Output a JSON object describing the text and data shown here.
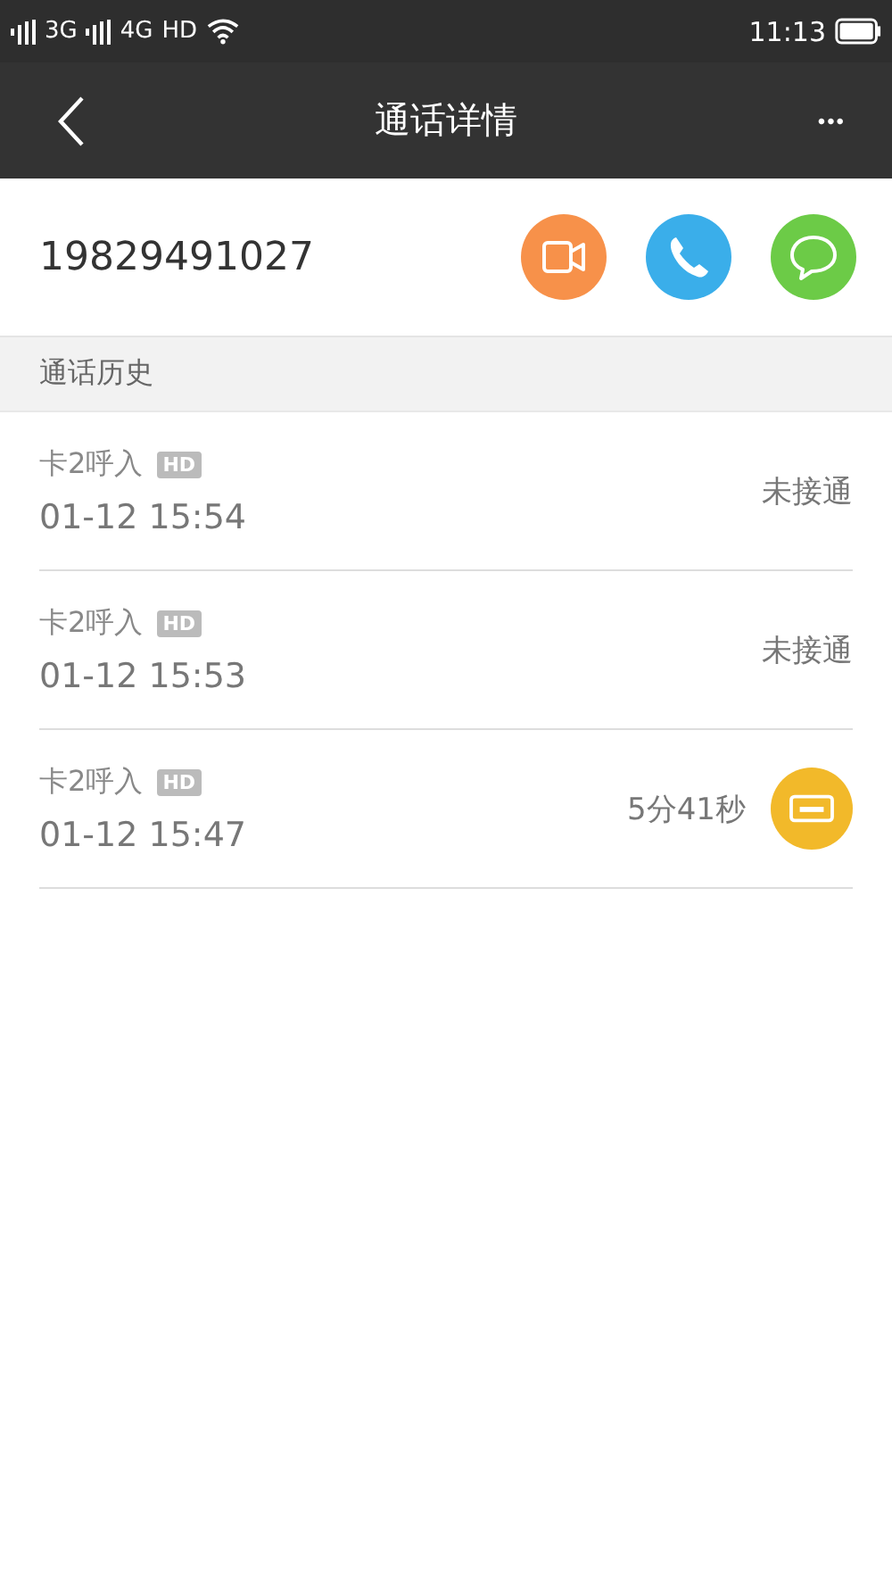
{
  "status_bar": {
    "network_1": "3G",
    "network_2": "4G",
    "hd": "HD",
    "time": "11:13"
  },
  "header": {
    "title": "通话详情",
    "more": "•••"
  },
  "contact": {
    "number": "19829491027"
  },
  "section": {
    "title": "通话历史"
  },
  "calls": [
    {
      "type": "卡2呼入",
      "badge": "HD",
      "time": "01-12 15:54",
      "result": "未接通",
      "recording": false
    },
    {
      "type": "卡2呼入",
      "badge": "HD",
      "time": "01-12 15:53",
      "result": "未接通",
      "recording": false
    },
    {
      "type": "卡2呼入",
      "badge": "HD",
      "time": "01-12 15:47",
      "result": "5分41秒",
      "recording": true
    }
  ]
}
